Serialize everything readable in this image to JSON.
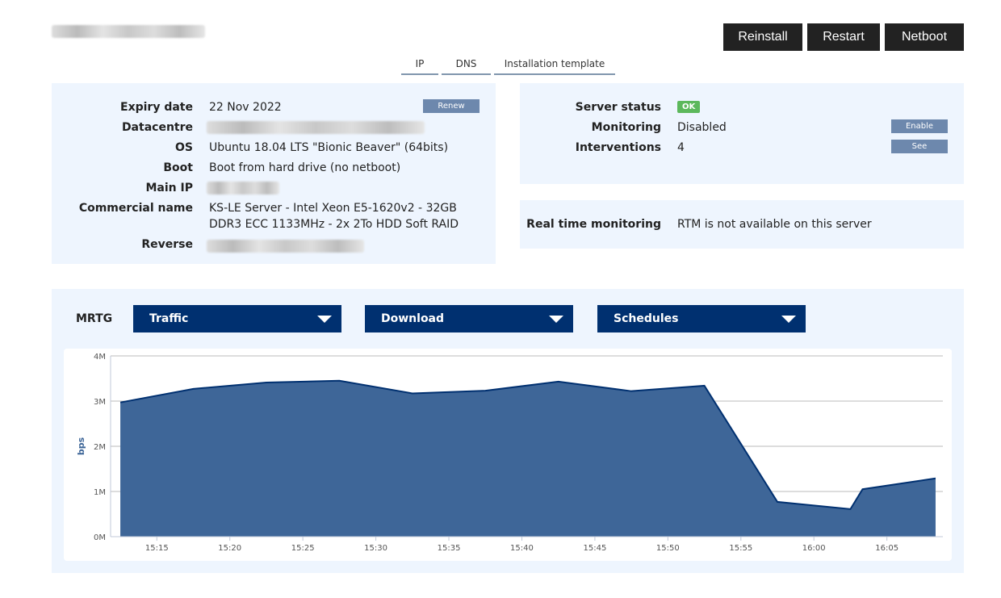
{
  "header": {
    "buttons": [
      "Reinstall",
      "Restart",
      "Netboot"
    ]
  },
  "tabs": [
    "IP",
    "DNS",
    "Installation template"
  ],
  "info": {
    "expiry_label": "Expiry date",
    "expiry_value": "22 Nov 2022",
    "renew": "Renew",
    "datacentre_label": "Datacentre",
    "os_label": "OS",
    "os_value": "Ubuntu 18.04 LTS \"Bionic Beaver\" (64bits)",
    "boot_label": "Boot",
    "boot_value": "Boot from hard drive (no netboot)",
    "ip_label": "Main IP",
    "commercial_label": "Commercial name",
    "commercial_value": "KS-LE Server - Intel Xeon E5-1620v2 - 32GB DDR3 ECC 1133MHz - 2x 2To HDD Soft RAID",
    "reverse_label": "Reverse"
  },
  "status": {
    "server_label": "Server status",
    "server_value": "OK",
    "ok_color": "#5cb85c",
    "monitoring_label": "Monitoring",
    "monitoring_value": "Disabled",
    "enable": "Enable",
    "interventions_label": "Interventions",
    "interventions_value": "4",
    "see": "See"
  },
  "rtm": {
    "label": "Real time monitoring",
    "value": "RTM is not available on this server"
  },
  "mrtg": {
    "label": "MRTG",
    "selects": [
      "Traffic",
      "Download",
      "Schedules"
    ]
  },
  "chart_data": {
    "type": "area",
    "ylabel": "bps",
    "ylim": [
      0,
      4000000
    ],
    "yticks": [
      "0M",
      "1M",
      "2M",
      "3M",
      "4M"
    ],
    "xticks": [
      "15:15",
      "15:20",
      "15:25",
      "15:30",
      "15:35",
      "15:40",
      "15:45",
      "15:50",
      "15:55",
      "16:00",
      "16:05"
    ],
    "xlim": [
      "15:11:50",
      "16:08:50"
    ],
    "x": [
      "15:12:30",
      "15:17:30",
      "15:22:30",
      "15:27:30",
      "15:32:30",
      "15:37:30",
      "15:42:30",
      "15:47:30",
      "15:52:30",
      "15:57:30",
      "16:02:30",
      "16:03:20",
      "16:08:20"
    ],
    "values": [
      2970000,
      3270000,
      3410000,
      3450000,
      3170000,
      3230000,
      3430000,
      3220000,
      3340000,
      770000,
      610000,
      1050000,
      1290000
    ],
    "fill": "#3e6698",
    "line": "#003070",
    "grid": true
  }
}
